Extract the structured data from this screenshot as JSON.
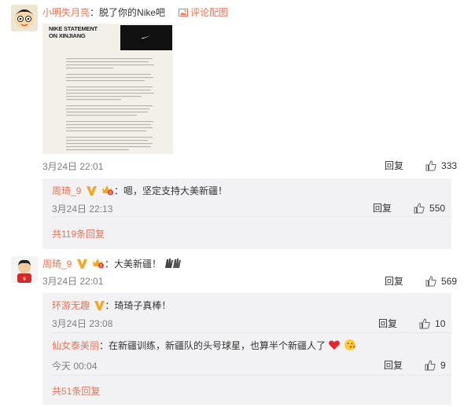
{
  "comment1": {
    "username": "小明失月亮",
    "colon": "：",
    "text": "脱了你的Nike吧",
    "image_link_label": "评论配图",
    "image_title_line1": "NIKE STATEMENT",
    "image_title_line2": "ON XINJIANG",
    "time": "3月24日 22:01",
    "reply_label": "回复",
    "like_count": "333",
    "subreply": {
      "username": "周琦_9",
      "text": "：嗯，坚定支持大美新疆！",
      "time": "3月24日 22:13",
      "reply_label": "回复",
      "like_count": "550"
    },
    "more_replies": "共119条回复"
  },
  "comment2": {
    "username": "周琦_9",
    "text": "：大美新疆！",
    "time": "3月24日 22:01",
    "reply_label": "回复",
    "like_count": "569",
    "subreplies": [
      {
        "username": "环游无趣",
        "text": "：琦琦子真棒！",
        "time": "3月24日 23:08",
        "reply_label": "回复",
        "like_count": "10"
      },
      {
        "username": "仙女泰美丽",
        "text": "：在新疆训练，新疆队的头号球星，也算半个新疆人了",
        "time": "今天 00:04",
        "reply_label": "回复",
        "like_count": "9"
      }
    ],
    "more_replies": "共51条回复"
  },
  "colors": {
    "username": "#eb7350",
    "subbox": "#f2f2f5",
    "verified": "#f5a623"
  }
}
